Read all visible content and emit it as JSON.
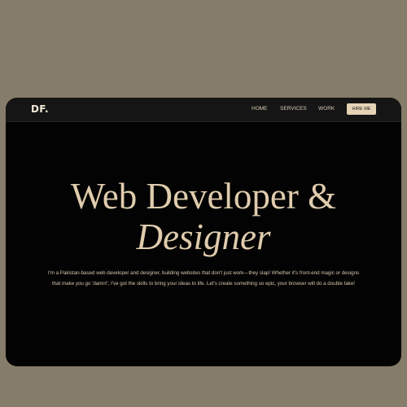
{
  "brand": {
    "logo": "DF."
  },
  "nav": {
    "home": "HOME",
    "services": "SERVICES",
    "work": "WORK",
    "hire": "HIRE ME"
  },
  "hero": {
    "title_line1": "Web Developer &",
    "title_line2": "Designer",
    "description": "I'm a Pakistan-based web developer and designer, building websites that don't just work—they slap! Whether it's front-end magic or designs that make you go 'damn!', I've got the skills to bring your ideas to life. Let's create something so epic, your browser will do a double take!"
  },
  "colors": {
    "page_background": "#857c69",
    "frame_background": "#030303",
    "navbar_background": "#151515",
    "accent": "#dfccad",
    "hire_button": "#e5d3b5"
  }
}
